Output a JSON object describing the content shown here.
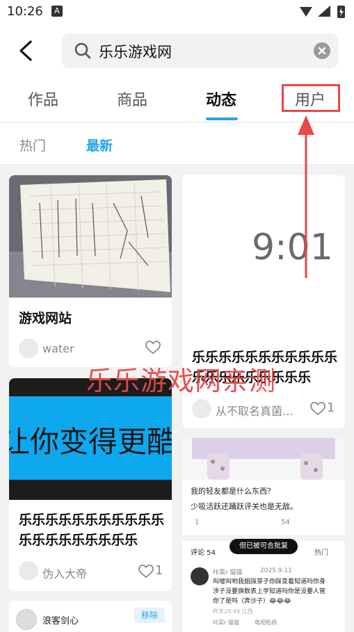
{
  "status_bar": {
    "time": "10:26",
    "a_icon": "A"
  },
  "search": {
    "query": "乐乐游戏网"
  },
  "tabs": [
    {
      "label": "作品"
    },
    {
      "label": "商品"
    },
    {
      "label": "动态"
    },
    {
      "label": "用户"
    }
  ],
  "subtabs": [
    {
      "label": "热门"
    },
    {
      "label": "最新"
    }
  ],
  "feed": {
    "left": [
      {
        "title": "游戏网站",
        "author": "water",
        "likes": ""
      },
      {
        "image_text": "让你变得更酷",
        "title": "乐乐乐乐乐乐乐乐乐乐乐乐乐乐乐乐乐乐乐乐",
        "author": "伪入大帝",
        "likes": "1"
      },
      {
        "author": "浪客剑心",
        "badge": "移除"
      }
    ],
    "right": [
      {
        "image_text": "9:01",
        "title": "乐乐乐乐乐乐乐乐乐乐乐乐乐乐乐乐乐乐乐乐",
        "author": "从不取名真菌…",
        "likes": "1"
      },
      {
        "text_line1": "我的轻友都是什么东西？",
        "text_line2": "少吸活跃还踊跃评关也是无敌。",
        "c1": "1",
        "c3": "54",
        "tooltip": "但已被可合批复",
        "comments_label": "评论 54",
        "sort_label": "热门",
        "comment_user": "咔菜r 猫猫",
        "comment_date": "2025.9.11",
        "comment_text": "叫嘘叫哟我姐踩芽子你踩变着知道吗你身涉子没要旗数表上学知道吗你是没要人管你了是吗（奔沙子）😂😂😂",
        "comment_time": "昨天20:49 江西",
        "reply_user": "咔菜r 猫猫",
        "reply_to": "电视柜柄"
      }
    ]
  },
  "watermark": "乐乐游戏网亲测"
}
